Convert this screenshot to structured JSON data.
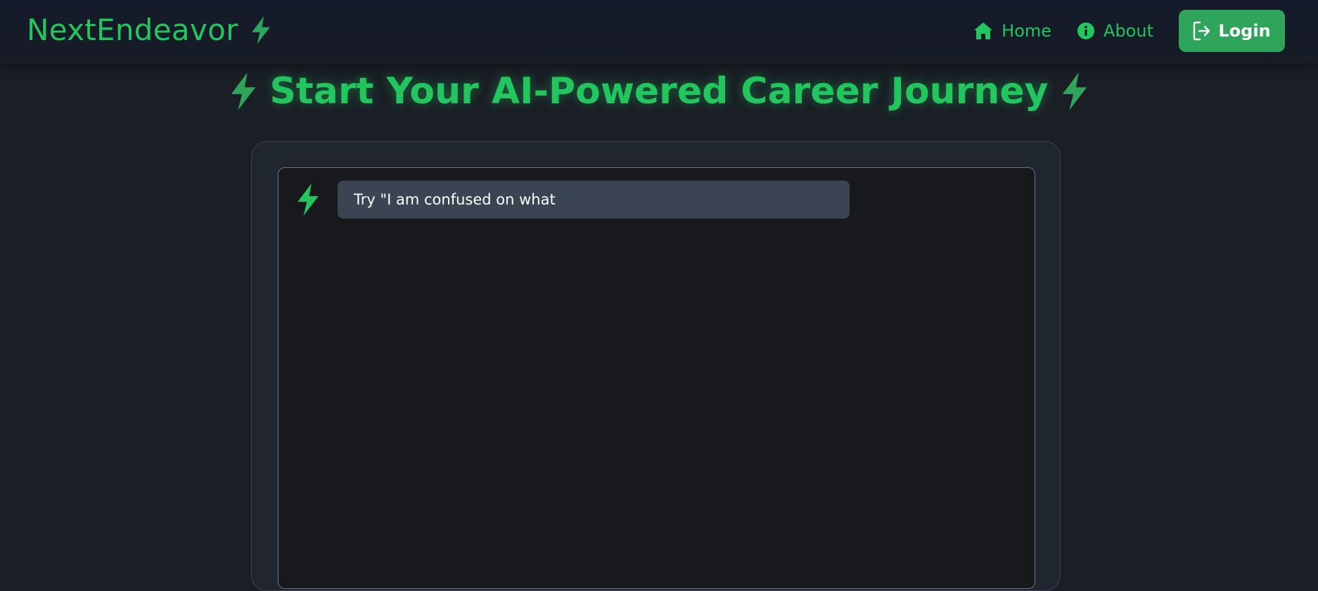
{
  "navbar": {
    "brand": "NextEndeavor",
    "brand_icon": "bolt-icon",
    "links": [
      {
        "label": "Home",
        "icon": "home-icon"
      },
      {
        "label": "About",
        "icon": "info-icon"
      }
    ],
    "login": {
      "label": "Login",
      "icon": "login-icon"
    }
  },
  "hero": {
    "title": "Start Your AI-Powered Career Journey",
    "icon": "bolt-icon"
  },
  "chat": {
    "messages": [
      {
        "sender_icon": "bolt-icon",
        "text": "Try \"I am confused on what"
      }
    ]
  },
  "colors": {
    "accent": "#22c55e",
    "button": "#2ea55a",
    "background": "#1a1f26",
    "bubble": "#3b4453"
  }
}
